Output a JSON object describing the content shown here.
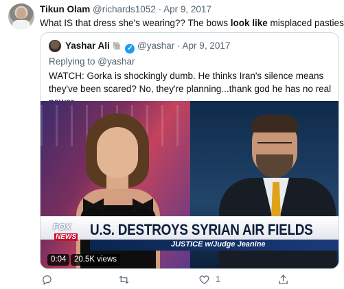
{
  "tweet": {
    "author_name": "Tikun Olam",
    "handle": "@richards1052",
    "separator": " · ",
    "date": "Apr 9, 2017",
    "text_before": "What IS that dress she's wearing??  The bows ",
    "text_bold": "look like",
    "text_after": " misplaced pasties!"
  },
  "quoted_tweet": {
    "author_name": "Yashar Ali",
    "emoji": "🐘",
    "handle": "@yashar",
    "separator": " · ",
    "date": "Apr 9, 2017",
    "replying_prefix": "Replying to ",
    "replying_handle": "@yashar",
    "text": "WATCH: Gorka is shockingly dumb. He thinks Iran's silence means they've been scared? No, they're planning...thank god he has no real power."
  },
  "video": {
    "chyron": "U.S. DESTROYS SYRIAN AIR FIELDS",
    "show_name": "JUSTICE w/Judge Jeanine",
    "logo_fox": "FOX",
    "logo_news": "NEWS",
    "duration": "0:04",
    "views": "20.5K views"
  },
  "actions": {
    "reply_count": "",
    "retweet_count": "",
    "like_count": "1",
    "share_count": ""
  },
  "colors": {
    "verified_badge": "#1d9bf0",
    "secondary_text": "#536471",
    "border": "#cfd9de"
  }
}
